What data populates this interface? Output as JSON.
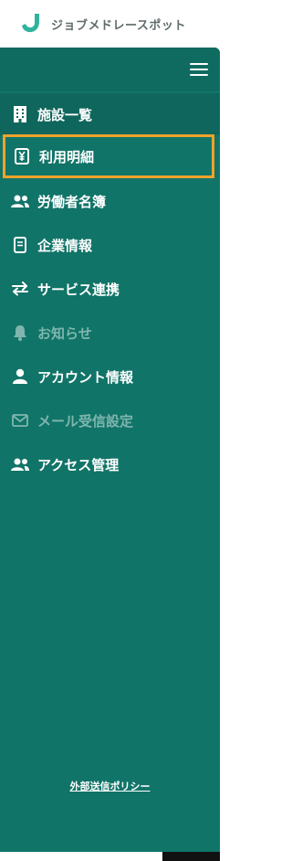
{
  "brand": {
    "name": "ジョブメドレースポット",
    "accent": "#2fb39e",
    "sidebar_color": "#117468",
    "highlight_color": "#f0a22a"
  },
  "sidebar": {
    "menu_icon": "hamburger-icon",
    "items": [
      {
        "label": "施設一覧",
        "icon": "building-icon",
        "state": "section"
      },
      {
        "label": "利用明細",
        "icon": "yen-receipt-icon",
        "state": "active"
      },
      {
        "label": "労働者名簿",
        "icon": "users-icon",
        "state": "normal"
      },
      {
        "label": "企業情報",
        "icon": "document-icon",
        "state": "normal"
      },
      {
        "label": "サービス連携",
        "icon": "swap-arrows-icon",
        "state": "normal"
      },
      {
        "label": "お知らせ",
        "icon": "bell-icon",
        "state": "disabled"
      },
      {
        "label": "アカウント情報",
        "icon": "user-icon",
        "state": "normal"
      },
      {
        "label": "メール受信設定",
        "icon": "mail-icon",
        "state": "disabled"
      },
      {
        "label": "アクセス管理",
        "icon": "users-icon",
        "state": "normal"
      }
    ],
    "footer_link": "外部送信ポリシー"
  }
}
